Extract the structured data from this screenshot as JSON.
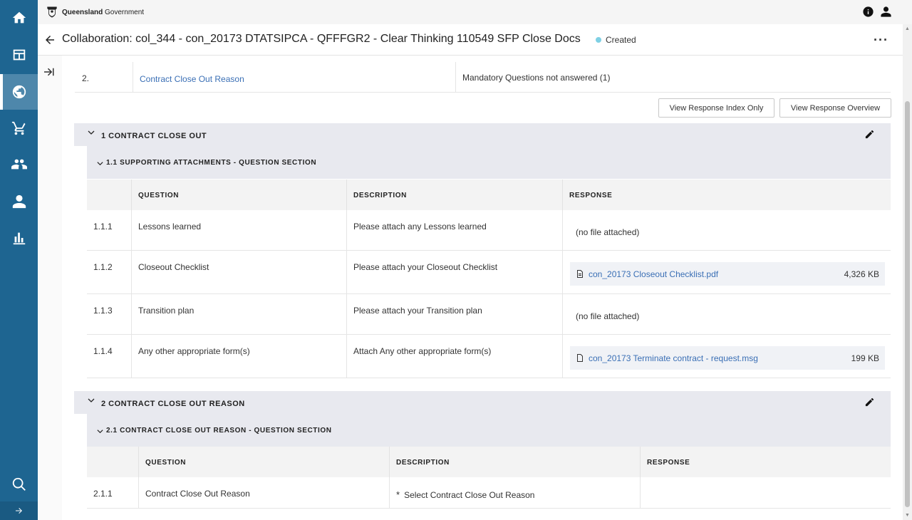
{
  "topbar": {
    "gov_name_bold": "Queensland",
    "gov_name_rest": "Government"
  },
  "header": {
    "title": "Collaboration: col_344 - con_20173 DTATSIPCA - QFFFGR2 - Clear Thinking 110549 SFP Close Docs",
    "status": "Created",
    "more": "···"
  },
  "nav": {
    "items": [
      "home-icon",
      "dashboard-icon",
      "collaboration-icon",
      "cart-icon",
      "suppliers-icon",
      "user-icon",
      "reports-icon"
    ],
    "search": "search-icon",
    "expand": "arrow-right-icon",
    "active_index": 2
  },
  "summary": {
    "index": "2.",
    "section_link": "Contract Close Out Reason",
    "message": "Mandatory Questions not answered (1)"
  },
  "buttons": {
    "index_only": "View Response Index Only",
    "overview": "View Response Overview"
  },
  "sections": [
    {
      "title": "1 CONTRACT CLOSE OUT",
      "subsection": "1.1 SUPPORTING ATTACHMENTS - QUESTION SECTION",
      "columns": [
        "QUESTION",
        "DESCRIPTION",
        "RESPONSE"
      ],
      "rows": [
        {
          "num": "1.1.1",
          "question": "Lessons learned",
          "description": "Please attach any Lessons learned",
          "response": "(no file attached)"
        },
        {
          "num": "1.1.2",
          "question": "Closeout Checklist",
          "description": "Please attach your Closeout Checklist",
          "file": "con_20173 Closeout Checklist.pdf",
          "size": "4,326 KB"
        },
        {
          "num": "1.1.3",
          "question": "Transition plan",
          "description": "Please attach your Transition plan",
          "response": "(no file attached)"
        },
        {
          "num": "1.1.4",
          "question": "Any other appropriate form(s)",
          "description": "Attach Any other appropriate form(s)",
          "file": "con_20173 Terminate contract - request.msg",
          "size": "199 KB"
        }
      ]
    },
    {
      "title": "2 CONTRACT CLOSE OUT REASON",
      "subsection": "2.1 CONTRACT CLOSE OUT REASON - QUESTION SECTION",
      "columns": [
        "QUESTION",
        "DESCRIPTION",
        "RESPONSE"
      ],
      "rows": [
        {
          "num": "2.1.1",
          "question": "Contract Close Out Reason",
          "required": "*",
          "description": "Select Contract Close Out Reason",
          "response": ""
        }
      ]
    }
  ]
}
